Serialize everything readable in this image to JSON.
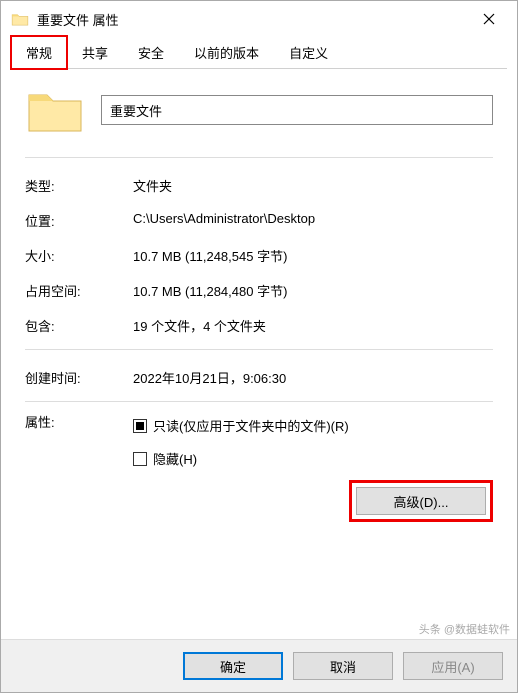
{
  "window": {
    "title": "重要文件 属性"
  },
  "tabs": {
    "items": [
      {
        "label": "常规"
      },
      {
        "label": "共享"
      },
      {
        "label": "安全"
      },
      {
        "label": "以前的版本"
      },
      {
        "label": "自定义"
      }
    ]
  },
  "general": {
    "name_value": "重要文件",
    "type_label": "类型:",
    "type_value": "文件夹",
    "location_label": "位置:",
    "location_value": "C:\\Users\\Administrator\\Desktop",
    "size_label": "大小:",
    "size_value": "10.7 MB (11,248,545 字节)",
    "sizeondisk_label": "占用空间:",
    "sizeondisk_value": "10.7 MB (11,284,480 字节)",
    "contains_label": "包含:",
    "contains_value": "19 个文件，4 个文件夹",
    "created_label": "创建时间:",
    "created_value": "2022年10月21日，9:06:30",
    "attributes_label": "属性:",
    "readonly_label": "只读(仅应用于文件夹中的文件)(R)",
    "hidden_label": "隐藏(H)",
    "advanced_label": "高级(D)..."
  },
  "footer": {
    "ok": "确定",
    "cancel": "取消",
    "apply": "应用(A)"
  },
  "watermark": "头条 @数据蛙软件"
}
